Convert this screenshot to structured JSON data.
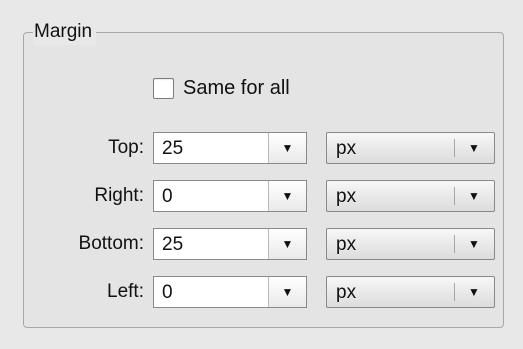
{
  "group": {
    "legend": "Margin"
  },
  "same_for_all": {
    "label": "Same for all",
    "checked": false
  },
  "rows": [
    {
      "label": "Top:",
      "value": "25",
      "unit": "px"
    },
    {
      "label": "Right:",
      "value": "0",
      "unit": "px"
    },
    {
      "label": "Bottom:",
      "value": "25",
      "unit": "px"
    },
    {
      "label": "Left:",
      "value": "0",
      "unit": "px"
    }
  ],
  "icons": {
    "dropdown_arrow": "▼"
  }
}
